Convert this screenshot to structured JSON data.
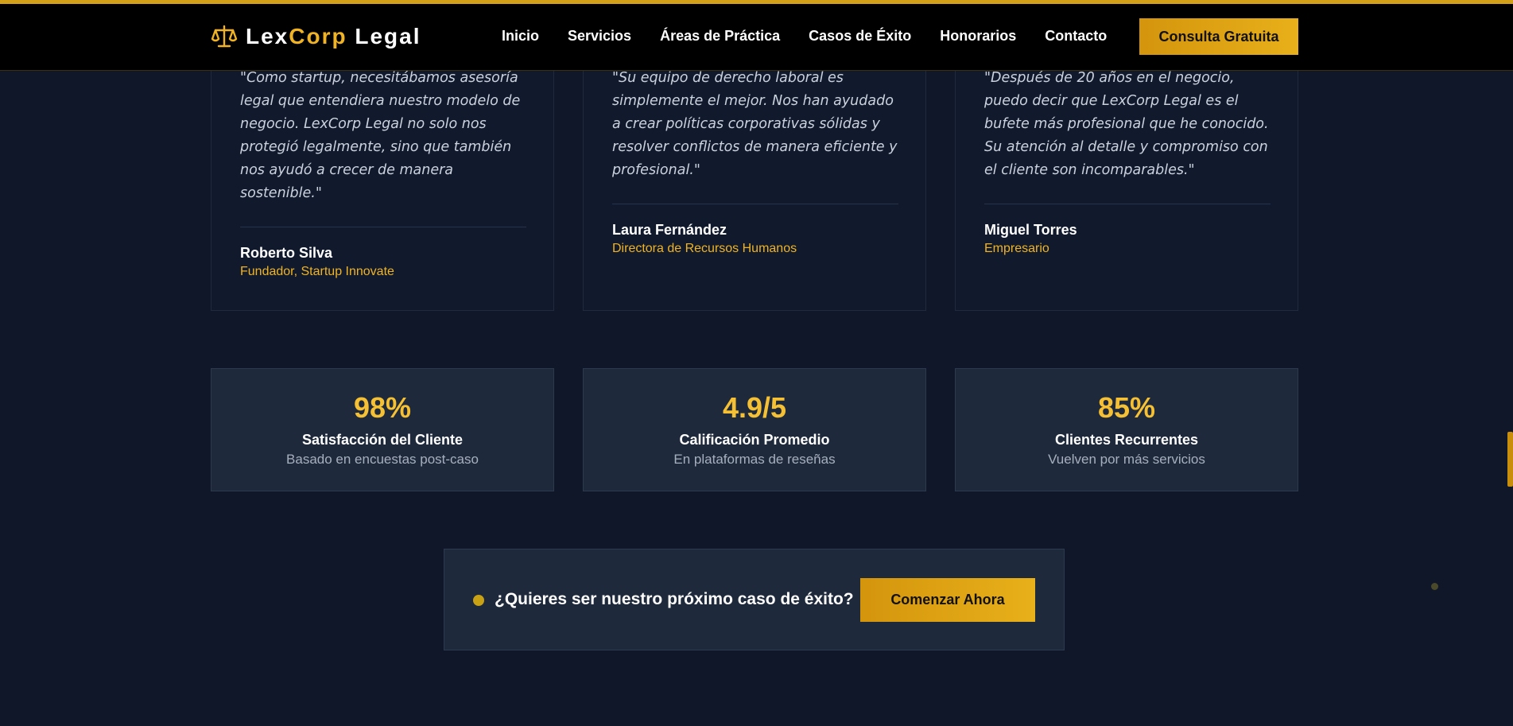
{
  "header": {
    "logo_prefix": "Lex",
    "logo_accent": "Corp",
    "logo_suffix": " Legal",
    "logo_icon": "scales-of-justice-icon",
    "nav": [
      {
        "label": "Inicio"
      },
      {
        "label": "Servicios"
      },
      {
        "label": "Áreas de Práctica"
      },
      {
        "label": "Casos de Éxito"
      },
      {
        "label": "Honorarios"
      },
      {
        "label": "Contacto"
      }
    ],
    "cta_label": "Consulta Gratuita"
  },
  "testimonials": [
    {
      "quote": "\"Como startup, necesitábamos asesoría legal que entendiera nuestro modelo de negocio. LexCorp Legal no solo nos protegió legalmente, sino que también nos ayudó a crecer de manera sostenible.\"",
      "name": "Roberto Silva",
      "role": "Fundador, Startup Innovate"
    },
    {
      "quote": "\"Su equipo de derecho laboral es simplemente el mejor. Nos han ayudado a crear políticas corporativas sólidas y resolver conflictos de manera eficiente y profesional.\"",
      "name": "Laura Fernández",
      "role": "Directora de Recursos Humanos"
    },
    {
      "quote": "\"Después de 20 años en el negocio, puedo decir que LexCorp Legal es el bufete más profesional que he conocido. Su atención al detalle y compromiso con el cliente son incomparables.\"",
      "name": "Miguel Torres",
      "role": "Empresario"
    }
  ],
  "stats": [
    {
      "value": "98%",
      "label": "Satisfacción del Cliente",
      "sub": "Basado en encuestas post-caso"
    },
    {
      "value": "4.9/5",
      "label": "Calificación Promedio",
      "sub": "En plataformas de reseñas"
    },
    {
      "value": "85%",
      "label": "Clientes Recurrentes",
      "sub": "Vuelven por más servicios"
    }
  ],
  "cta": {
    "text": "¿Quieres ser nuestro próximo caso de éxito?",
    "button": "Comenzar Ahora"
  },
  "colors": {
    "background": "#0f1729",
    "accent": "#f0b323",
    "card": "#1e293b"
  }
}
